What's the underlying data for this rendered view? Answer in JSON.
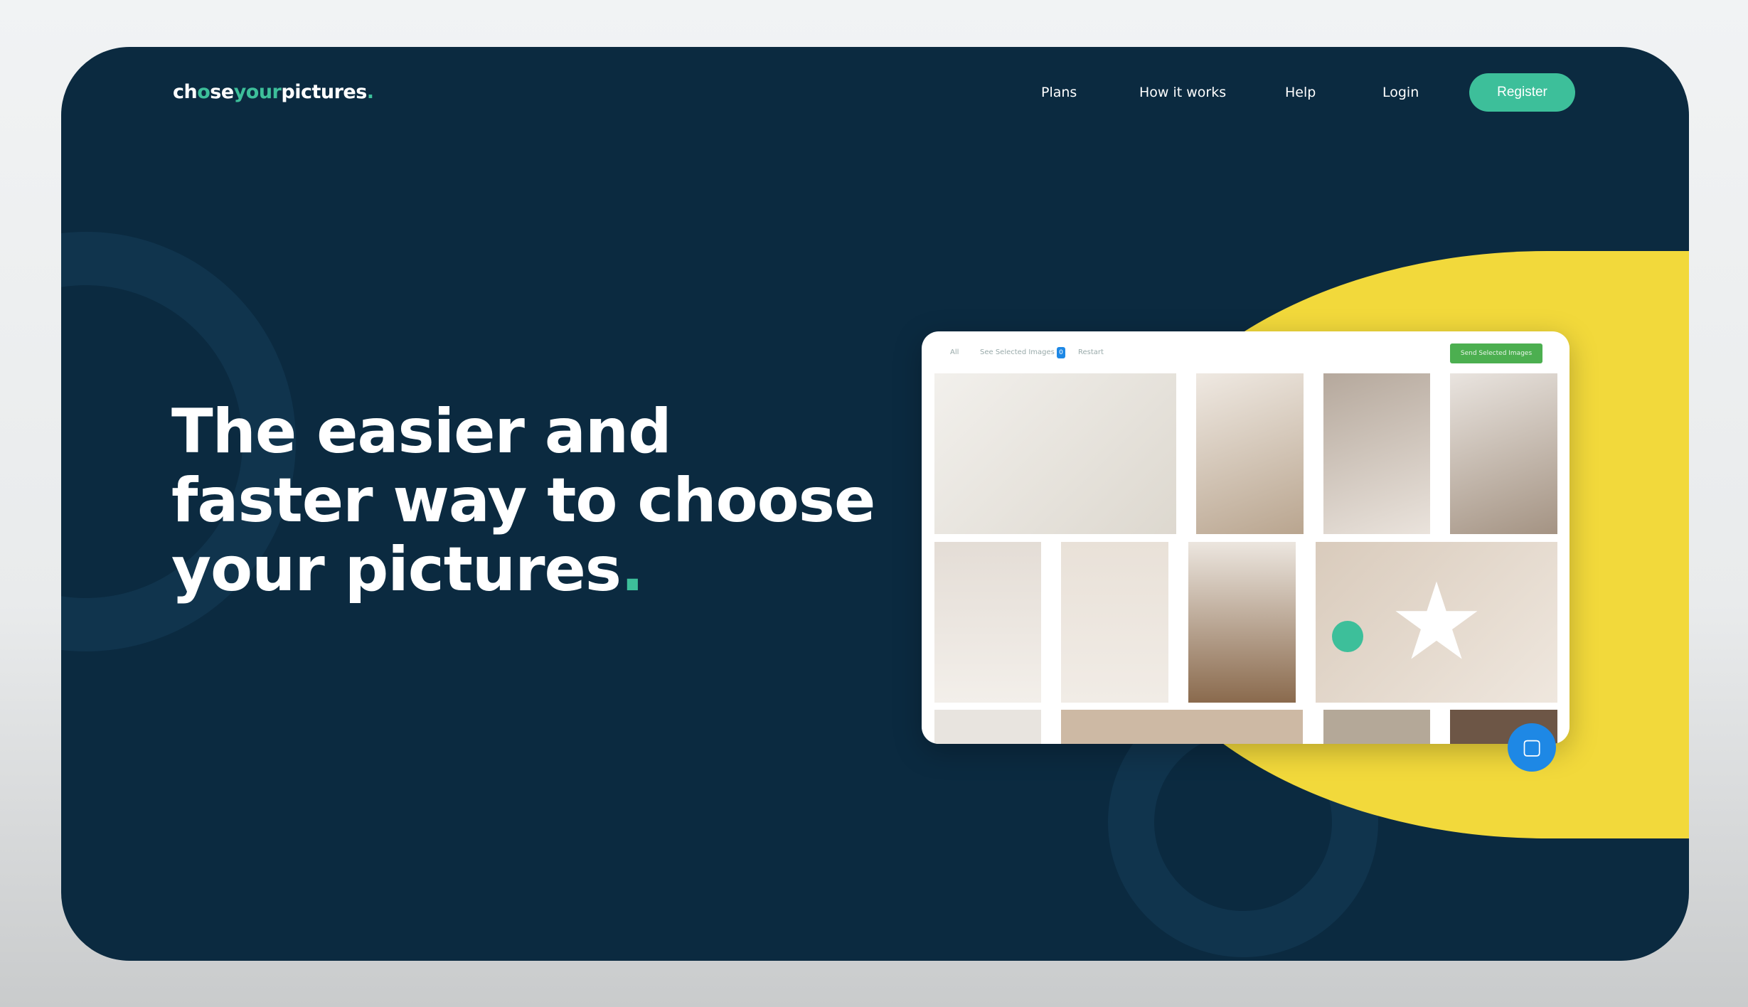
{
  "header": {
    "logo": {
      "part1": "ch",
      "part2": "o",
      "part3": "se",
      "part4": "your",
      "part5": "pictures",
      "part6": "."
    },
    "nav": [
      "Plans",
      "How it works",
      "Help",
      "Login"
    ],
    "register": "Register"
  },
  "hero": {
    "line1": "The easier and",
    "line2": "faster way to choose",
    "line3": "your pictures",
    "dot": "."
  },
  "mockup": {
    "tabs": [
      "All",
      "See Selected Images",
      "Restart"
    ],
    "selected_count": "0",
    "send_button": "Send Selected Images"
  },
  "colors": {
    "background": "#0b2a40",
    "accent": "#3dbf9a",
    "yellow": "#f2d93b",
    "chat": "#1e88e5",
    "send": "#4caf50"
  },
  "icons": {
    "chat": "chat-bubble-icon",
    "favorite": "star-icon"
  }
}
